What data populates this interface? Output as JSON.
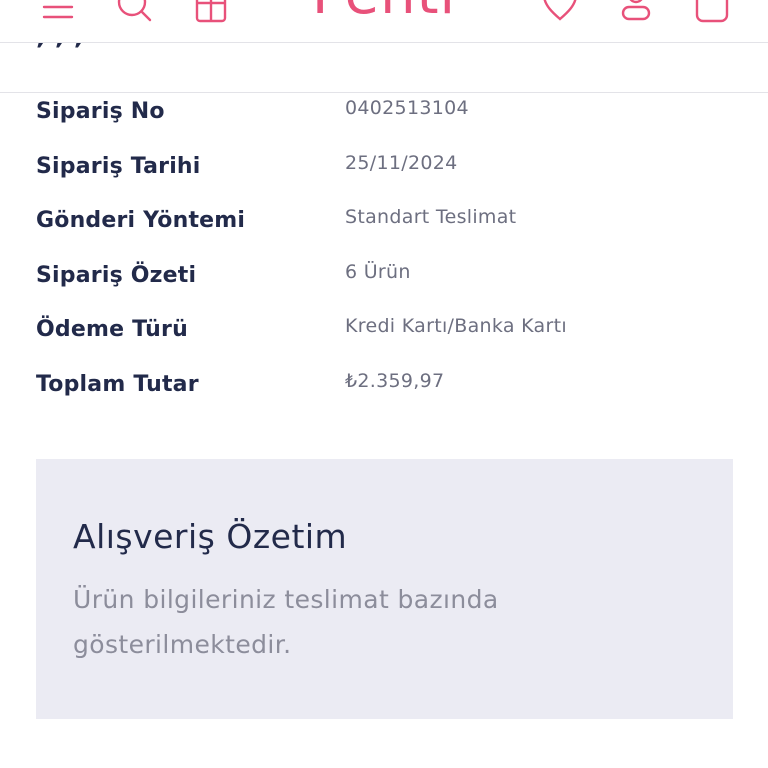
{
  "header": {
    "brand": "Penti",
    "icons": [
      "menu-icon",
      "search-icon",
      "gift-icon",
      "heart-icon",
      "user-icon",
      "cart-icon"
    ],
    "accent_color": "#e8517a"
  },
  "sub_header": {
    "title_cut": ", ,     ,"
  },
  "order_details": [
    {
      "label": "Sipariş No",
      "value": "0402513104"
    },
    {
      "label": "Sipariş Tarihi",
      "value": "25/11/2024"
    },
    {
      "label": "Gönderi Yöntemi",
      "value": "Standart Teslimat"
    },
    {
      "label": "Sipariş Özeti",
      "value": "6 Ürün"
    },
    {
      "label": "Ödeme Türü",
      "value": "Kredi Kartı/Banka Kartı"
    },
    {
      "label": "Toplam Tutar",
      "value": "₺2.359,97"
    }
  ],
  "summary": {
    "title": "Alışveriş Özetim",
    "text": "Ürün bilgileriniz teslimat bazında gösterilmektedir."
  },
  "colors": {
    "text_dark": "#222a4a",
    "text_muted": "#6d6f80",
    "summary_bg": "#ebebf3"
  }
}
